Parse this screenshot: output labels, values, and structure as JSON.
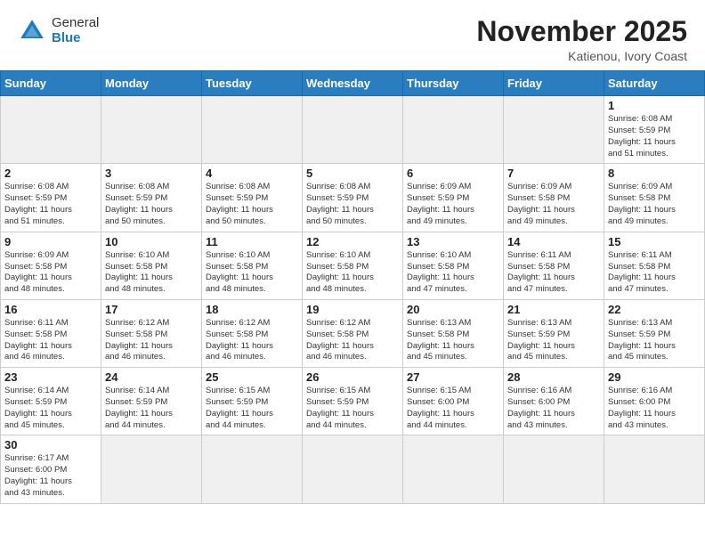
{
  "header": {
    "logo_general": "General",
    "logo_blue": "Blue",
    "month_title": "November 2025",
    "location": "Katienou, Ivory Coast"
  },
  "weekdays": [
    "Sunday",
    "Monday",
    "Tuesday",
    "Wednesday",
    "Thursday",
    "Friday",
    "Saturday"
  ],
  "days": [
    {
      "num": "",
      "info": "",
      "empty": true
    },
    {
      "num": "",
      "info": "",
      "empty": true
    },
    {
      "num": "",
      "info": "",
      "empty": true
    },
    {
      "num": "",
      "info": "",
      "empty": true
    },
    {
      "num": "",
      "info": "",
      "empty": true
    },
    {
      "num": "",
      "info": "",
      "empty": true
    },
    {
      "num": "1",
      "info": "Sunrise: 6:08 AM\nSunset: 5:59 PM\nDaylight: 11 hours\nand 51 minutes."
    },
    {
      "num": "2",
      "info": "Sunrise: 6:08 AM\nSunset: 5:59 PM\nDaylight: 11 hours\nand 51 minutes."
    },
    {
      "num": "3",
      "info": "Sunrise: 6:08 AM\nSunset: 5:59 PM\nDaylight: 11 hours\nand 50 minutes."
    },
    {
      "num": "4",
      "info": "Sunrise: 6:08 AM\nSunset: 5:59 PM\nDaylight: 11 hours\nand 50 minutes."
    },
    {
      "num": "5",
      "info": "Sunrise: 6:08 AM\nSunset: 5:59 PM\nDaylight: 11 hours\nand 50 minutes."
    },
    {
      "num": "6",
      "info": "Sunrise: 6:09 AM\nSunset: 5:59 PM\nDaylight: 11 hours\nand 49 minutes."
    },
    {
      "num": "7",
      "info": "Sunrise: 6:09 AM\nSunset: 5:58 PM\nDaylight: 11 hours\nand 49 minutes."
    },
    {
      "num": "8",
      "info": "Sunrise: 6:09 AM\nSunset: 5:58 PM\nDaylight: 11 hours\nand 49 minutes."
    },
    {
      "num": "9",
      "info": "Sunrise: 6:09 AM\nSunset: 5:58 PM\nDaylight: 11 hours\nand 48 minutes."
    },
    {
      "num": "10",
      "info": "Sunrise: 6:10 AM\nSunset: 5:58 PM\nDaylight: 11 hours\nand 48 minutes."
    },
    {
      "num": "11",
      "info": "Sunrise: 6:10 AM\nSunset: 5:58 PM\nDaylight: 11 hours\nand 48 minutes."
    },
    {
      "num": "12",
      "info": "Sunrise: 6:10 AM\nSunset: 5:58 PM\nDaylight: 11 hours\nand 48 minutes."
    },
    {
      "num": "13",
      "info": "Sunrise: 6:10 AM\nSunset: 5:58 PM\nDaylight: 11 hours\nand 47 minutes."
    },
    {
      "num": "14",
      "info": "Sunrise: 6:11 AM\nSunset: 5:58 PM\nDaylight: 11 hours\nand 47 minutes."
    },
    {
      "num": "15",
      "info": "Sunrise: 6:11 AM\nSunset: 5:58 PM\nDaylight: 11 hours\nand 47 minutes."
    },
    {
      "num": "16",
      "info": "Sunrise: 6:11 AM\nSunset: 5:58 PM\nDaylight: 11 hours\nand 46 minutes."
    },
    {
      "num": "17",
      "info": "Sunrise: 6:12 AM\nSunset: 5:58 PM\nDaylight: 11 hours\nand 46 minutes."
    },
    {
      "num": "18",
      "info": "Sunrise: 6:12 AM\nSunset: 5:58 PM\nDaylight: 11 hours\nand 46 minutes."
    },
    {
      "num": "19",
      "info": "Sunrise: 6:12 AM\nSunset: 5:58 PM\nDaylight: 11 hours\nand 46 minutes."
    },
    {
      "num": "20",
      "info": "Sunrise: 6:13 AM\nSunset: 5:58 PM\nDaylight: 11 hours\nand 45 minutes."
    },
    {
      "num": "21",
      "info": "Sunrise: 6:13 AM\nSunset: 5:59 PM\nDaylight: 11 hours\nand 45 minutes."
    },
    {
      "num": "22",
      "info": "Sunrise: 6:13 AM\nSunset: 5:59 PM\nDaylight: 11 hours\nand 45 minutes."
    },
    {
      "num": "23",
      "info": "Sunrise: 6:14 AM\nSunset: 5:59 PM\nDaylight: 11 hours\nand 45 minutes."
    },
    {
      "num": "24",
      "info": "Sunrise: 6:14 AM\nSunset: 5:59 PM\nDaylight: 11 hours\nand 44 minutes."
    },
    {
      "num": "25",
      "info": "Sunrise: 6:15 AM\nSunset: 5:59 PM\nDaylight: 11 hours\nand 44 minutes."
    },
    {
      "num": "26",
      "info": "Sunrise: 6:15 AM\nSunset: 5:59 PM\nDaylight: 11 hours\nand 44 minutes."
    },
    {
      "num": "27",
      "info": "Sunrise: 6:15 AM\nSunset: 6:00 PM\nDaylight: 11 hours\nand 44 minutes."
    },
    {
      "num": "28",
      "info": "Sunrise: 6:16 AM\nSunset: 6:00 PM\nDaylight: 11 hours\nand 43 minutes."
    },
    {
      "num": "29",
      "info": "Sunrise: 6:16 AM\nSunset: 6:00 PM\nDaylight: 11 hours\nand 43 minutes."
    },
    {
      "num": "30",
      "info": "Sunrise: 6:17 AM\nSunset: 6:00 PM\nDaylight: 11 hours\nand 43 minutes."
    },
    {
      "num": "",
      "info": "",
      "empty": true
    },
    {
      "num": "",
      "info": "",
      "empty": true
    },
    {
      "num": "",
      "info": "",
      "empty": true
    },
    {
      "num": "",
      "info": "",
      "empty": true
    },
    {
      "num": "",
      "info": "",
      "empty": true
    },
    {
      "num": "",
      "info": "",
      "empty": true
    }
  ]
}
